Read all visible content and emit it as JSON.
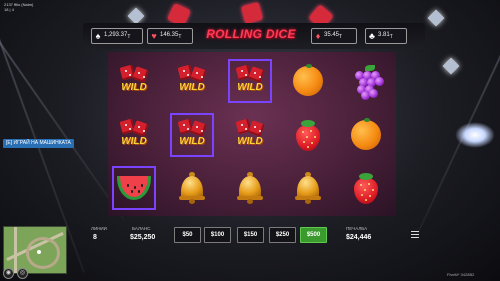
{
  "hud": {
    "line1": "2137 fflio (Naim)",
    "line2": "18 | 4"
  },
  "chat": {
    "tag": "[E] ИГРАЙ НА МАШИНКАТА"
  },
  "watermark": "FiveM* 3428B2",
  "minimap": {
    "icons": [
      "eye-icon",
      "eye-off-icon"
    ]
  },
  "machine": {
    "title": "ROLLING DICE",
    "stats": [
      {
        "icon": "spade-icon",
        "glyph": "♠",
        "value": "1,293.37",
        "sub": "T"
      },
      {
        "icon": "heart-icon",
        "glyph": "♥",
        "value": "146.35",
        "sub": "T"
      },
      {
        "icon": "diamond-icon",
        "glyph": "♦",
        "value": "35.45",
        "sub": "T"
      },
      {
        "icon": "club-icon",
        "glyph": "♣",
        "value": "3.81",
        "sub": "T"
      }
    ],
    "grid": [
      [
        "wild",
        "wild",
        "wild",
        "orange",
        "grapes"
      ],
      [
        "wild",
        "wild",
        "wild",
        "strawberry",
        "orange"
      ],
      [
        "watermelon",
        "bell",
        "bell",
        "bell",
        "strawberry"
      ]
    ],
    "highlighted": [
      [
        0,
        2
      ],
      [
        1,
        1
      ],
      [
        2,
        0
      ]
    ],
    "wild_text": "WILD",
    "bottom": {
      "lines_label": "ЛИНИИ",
      "lines_value": "8",
      "balance_label": "БАЛАНС",
      "balance_value": "$25,250",
      "bets": [
        "$50",
        "$100",
        "$150",
        "$250",
        "$500"
      ],
      "selected_bet": "$500",
      "winnings_label": "ПЕЧАЛБА",
      "winnings_value": "$24,446"
    },
    "colors": {
      "title": "#ff3b55",
      "highlight": "#7a44ff",
      "selected_bet": "#3a9a2e"
    }
  }
}
